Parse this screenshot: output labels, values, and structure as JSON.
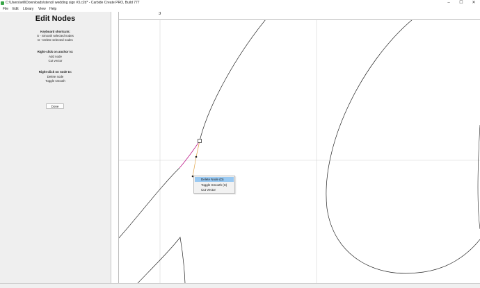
{
  "window": {
    "title": "C:\\Users\\will\\Downloads\\stencil wedding sign #3.c2d* - Carbide Create PRO, Build 777",
    "minimize_glyph": "–",
    "maximize_glyph": "☐",
    "close_glyph": "✕"
  },
  "menu": [
    "File",
    "Edit",
    "Library",
    "View",
    "Help"
  ],
  "panel": {
    "heading": "Edit Nodes",
    "kbd_title": "Keyboard shortcuts:",
    "kbd_1": "S - Smooth selected nodes",
    "kbd_2": "D - Delete selected nodes",
    "anchor_title": "Right-click on anchor to:",
    "anchor_1": "Add node",
    "anchor_2": "Cut vector",
    "node_title": "Right-click on node to:",
    "node_1": "Delete node",
    "node_2": "Toggle smooth",
    "done": "Done"
  },
  "ruler": {
    "h_label": "3"
  },
  "context_menu": {
    "items": [
      "Delete Node (D)",
      "Toggle Smooth (S)",
      "Cut Vector"
    ],
    "highlighted": 0
  },
  "colors": {
    "ruler_marker": "#e8202a",
    "path": "#222222",
    "selected_segment": "#c0208c",
    "handle": "#e0a040",
    "menu_highlight": "#99c9f2",
    "app_icon": "#3aa648"
  }
}
